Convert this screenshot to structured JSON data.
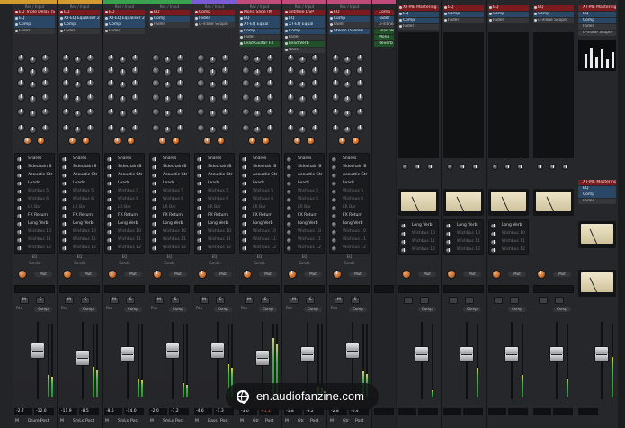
{
  "strips": [
    {
      "name": "Snare Delay",
      "name_color": "#e08a3a",
      "top_color": "#d39a2e",
      "io_label": "Rec / Input",
      "inserts": [
        {
          "label": "EQ Triple Delay (S",
          "kind": "red"
        },
        {
          "label": "EQ",
          "kind": "blue"
        },
        {
          "label": "Comp",
          "kind": "blue"
        },
        {
          "label": "Fader",
          "kind": "grey"
        }
      ],
      "sends": [
        "Snares",
        "Sidechain B",
        "Acoustic Gtr",
        "Leads",
        "Wishbus 5",
        "Wishbus 6",
        "LR Bar",
        "FX Return",
        "Long Verb",
        "Wishbus 10",
        "Wishbus 11",
        "Wishbus 12"
      ],
      "level": "-2.7",
      "peak": "-12.0",
      "peak_red": false,
      "meter": 0.3,
      "fader": 0.55,
      "pan_label": "Pan",
      "bus_label": "EQ",
      "send_label": "Sends",
      "mute": "M",
      "solo": "S",
      "footer": [
        "M",
        "Drums",
        "Post"
      ]
    },
    {
      "name": "Loop 1",
      "name_color": "#e08a3a",
      "top_color": "#d39a2e",
      "io_label": "Rec / Input",
      "inserts": [
        {
          "label": "EQ",
          "kind": "red"
        },
        {
          "label": "XT-EQ Equaliser 2",
          "kind": "blue"
        },
        {
          "label": "Comp",
          "kind": "blue"
        },
        {
          "label": "Fader",
          "kind": "grey"
        }
      ],
      "sends": [
        "Snares",
        "Sidechain B",
        "Acoustic Gtr",
        "Leads",
        "Wishbus 5",
        "Wishbus 6",
        "LR Bar",
        "FX Return",
        "Long Verb",
        "Wishbus 10",
        "Wishbus 11",
        "Wishbus 12"
      ],
      "level": "-11.9",
      "peak": "-8.5",
      "peak_red": false,
      "meter": 0.42,
      "fader": 0.45,
      "pan_label": "Pan",
      "bus_label": "EQ",
      "send_label": "Sends",
      "mute": "M",
      "solo": "S",
      "footer": [
        "M",
        "SmLs",
        "Post"
      ]
    },
    {
      "name": "Loop 2",
      "name_color": "#e08a3a",
      "top_color": "#3aa24f",
      "io_label": "Rec / Input",
      "inserts": [
        {
          "label": "EQ",
          "kind": "red"
        },
        {
          "label": "XT-EQ Equaliser 2",
          "kind": "blue"
        },
        {
          "label": "Comp",
          "kind": "blue"
        },
        {
          "label": "Fader",
          "kind": "grey"
        }
      ],
      "sends": [
        "Snares",
        "Sidechain B",
        "Acoustic Gtr",
        "Leads",
        "Wishbus 5",
        "Wishbus 6",
        "LR Bar",
        "FX Return",
        "Long Verb",
        "Wishbus 10",
        "Wishbus 11",
        "Wishbus 12"
      ],
      "level": "-8.5",
      "peak": "-14.0",
      "peak_red": false,
      "meter": 0.25,
      "fader": 0.5,
      "pan_label": "Pan",
      "bus_label": "EQ",
      "send_label": "Sends",
      "mute": "M",
      "solo": "S",
      "footer": [
        "M",
        "SmLs",
        "Post"
      ]
    },
    {
      "name": "Swell",
      "name_color": "#5bc36a",
      "top_color": "#3aa24f",
      "io_label": "Rec / Input",
      "inserts": [
        {
          "label": "EQ",
          "kind": "red"
        },
        {
          "label": "Comp",
          "kind": "blue"
        },
        {
          "label": "Fader",
          "kind": "grey"
        }
      ],
      "sends": [
        "Snares",
        "Sidechain B",
        "Acoustic Gtr",
        "Leads",
        "Wishbus 5",
        "Wishbus 6",
        "LR Bar",
        "FX Return",
        "Long Verb",
        "Wishbus 10",
        "Wishbus 11",
        "Wishbus 12"
      ],
      "level": "-2.0",
      "peak": "-7.2",
      "peak_red": false,
      "meter": 0.2,
      "fader": 0.55,
      "pan_label": "Pan",
      "bus_label": "EQ",
      "send_label": "Sends",
      "mute": "M",
      "solo": "S",
      "footer": [
        "M",
        "SmLs",
        "Post"
      ]
    },
    {
      "name": "Bass",
      "name_color": "#4f7fd6",
      "top_color": "#7b5bd6",
      "io_label": "Rec / Input",
      "inserts": [
        {
          "label": "Comp",
          "kind": "red"
        },
        {
          "label": "Fader",
          "kind": "blue"
        },
        {
          "label": "u-inline Scope",
          "kind": "grey"
        }
      ],
      "sends": [
        "Snares",
        "Sidechain B",
        "Acoustic Gtr",
        "Leads",
        "Wishbus 5",
        "Wishbus 6",
        "LR Bar",
        "FX Return",
        "Long Verb",
        "Wishbus 10",
        "Wishbus 11",
        "Wishbus 12"
      ],
      "level": "-4.6",
      "peak": "-1.3",
      "peak_red": false,
      "meter": 0.45,
      "fader": 0.55,
      "pan_label": "Pan",
      "bus_label": "EQ",
      "send_label": "Sends",
      "mute": "M",
      "solo": "S",
      "footer": [
        "M",
        "Bass",
        "Post"
      ]
    },
    {
      "name": "Lead Guitar",
      "name_color": "#e05a5a",
      "top_color": "#c04a7a",
      "io_label": "Rec / Input",
      "inserts": [
        {
          "label": "Mono Slide (M",
          "kind": "red"
        },
        {
          "label": "EQ",
          "kind": "blue"
        },
        {
          "label": "XT-EQ Equal",
          "kind": "blue"
        },
        {
          "label": "Comp",
          "kind": "blue"
        },
        {
          "label": "Fader",
          "kind": "grey"
        },
        {
          "label": "Lead Guitar FX",
          "kind": "grn"
        }
      ],
      "sends": [
        "Snares",
        "Sidechain B",
        "Acoustic Gtr",
        "Leads",
        "Wishbus 5",
        "Wishbus 6",
        "LR Bar",
        "FX Return",
        "Long Verb",
        "Wishbus 10",
        "Wishbus 11",
        "Wishbus 12"
      ],
      "level": "-3.0",
      "peak": "+1.2",
      "peak_red": true,
      "meter": 0.8,
      "fader": 0.45,
      "pan_label": "Pan",
      "bus_label": "EQ",
      "send_label": "Sends",
      "mute": "M",
      "solo": "S",
      "footer": [
        "M",
        "Gtr",
        "Post"
      ]
    },
    {
      "name": "MIDI",
      "name_color": "#d04ab0",
      "top_color": "#c04a7a",
      "io_label": "Rec / Input",
      "inserts": [
        {
          "label": "antifree DSP",
          "kind": "red"
        },
        {
          "label": "EQ",
          "kind": "blue"
        },
        {
          "label": "XT-EQ Equal",
          "kind": "blue"
        },
        {
          "label": "Comp",
          "kind": "blue"
        },
        {
          "label": "Fader",
          "kind": "grey"
        },
        {
          "label": "Lead Verb",
          "kind": "grn"
        },
        {
          "label": "Bass",
          "kind": "grey"
        }
      ],
      "sends": [
        "Snares",
        "Sidechain B",
        "Acoustic Gtr",
        "Leads",
        "Wishbus 5",
        "Wishbus 6",
        "LR Bar",
        "FX Return",
        "Long Verb",
        "Wishbus 10",
        "Wishbus 11",
        "Wishbus 12"
      ],
      "level": "-5.8",
      "peak": "-9.2",
      "peak_red": false,
      "meter": 0.15,
      "fader": 0.5,
      "pan_label": "Pan",
      "bus_label": "EQ",
      "send_label": "Sends",
      "mute": "M",
      "solo": "S",
      "footer": [
        "M",
        "Gtr",
        "Post"
      ]
    },
    {
      "name": "Lead Guitar FX",
      "name_color": "#e05a5a",
      "top_color": "#c04a7a",
      "io_label": "Rec / Input",
      "inserts": [
        {
          "label": "EQ",
          "kind": "red"
        },
        {
          "label": "Comp",
          "kind": "blue"
        },
        {
          "label": "Fader",
          "kind": "grey"
        },
        {
          "label": "Stereo (Sterel)",
          "kind": "blue"
        }
      ],
      "sends": [
        "Snares",
        "Sidechain B",
        "Acoustic Gtr",
        "Leads",
        "Wishbus 5",
        "Wishbus 6",
        "LR Bar",
        "FX Return",
        "Long Verb",
        "Wishbus 10",
        "Wishbus 11",
        "Wishbus 12"
      ],
      "level": "-2.8",
      "peak": "-0.4",
      "peak_red": false,
      "meter": 0.35,
      "fader": 0.55,
      "pan_label": "Pan",
      "bus_label": "EQ",
      "send_label": "Sends",
      "mute": "M",
      "solo": "S",
      "footer": [
        "M",
        "Gtr",
        "Post"
      ]
    }
  ],
  "right_edge_strip": {
    "label": "Cho",
    "name_color": "#d04ab0",
    "inserts": [
      {
        "label": "Comp",
        "kind": "red"
      },
      {
        "label": "Fader",
        "kind": "blue"
      },
      {
        "label": "u-inline Sc",
        "kind": "grey"
      },
      {
        "label": "Lead Verb",
        "kind": "grn"
      },
      {
        "label": "Mono",
        "kind": "grn"
      },
      {
        "label": "Reverb",
        "kind": "grn"
      }
    ],
    "level": "-12.3"
  },
  "fx_strips": [
    {
      "name": "Leads",
      "name_color": "#5bc36a",
      "inserts": [
        {
          "label": "XT-ME Mastering 1",
          "kind": "red"
        },
        {
          "label": "EQ",
          "kind": "blue"
        },
        {
          "label": "Comp",
          "kind": "blue"
        },
        {
          "label": "Fader",
          "kind": "grey"
        }
      ],
      "sends": [
        "Long Verb",
        "Wishbus 10",
        "Wishbus 11",
        "Wishbus 12"
      ],
      "level": "-2.6",
      "peak": "-8.3",
      "meter": 0.1,
      "fader": 0.5,
      "split_label": "Split",
      "mute": "M",
      "solo": "S",
      "footer": [
        "M",
        "Bal/Ins",
        "Post"
      ]
    },
    {
      "name": "LD Gtr",
      "name_color": "#5bc36a",
      "inserts": [
        {
          "label": "EQ",
          "kind": "red"
        },
        {
          "label": "Comp",
          "kind": "blue"
        },
        {
          "label": "Fader",
          "kind": "grey"
        }
      ],
      "sends": [
        "Long Verb",
        "Wishbus 10",
        "Wishbus 11",
        "Wishbus 12"
      ],
      "level": "-1.0",
      "peak": "-4.6",
      "meter": 0.4,
      "fader": 0.5,
      "split_label": "Split",
      "mute": "M",
      "solo": "S",
      "footer": [
        "M",
        "Bal/Ins",
        "Post"
      ]
    },
    {
      "name": "FX Return",
      "name_color": "#5bc36a",
      "inserts": [
        {
          "label": "EQ",
          "kind": "red"
        },
        {
          "label": "Comp",
          "kind": "blue"
        },
        {
          "label": "Fader",
          "kind": "grey"
        }
      ],
      "sends": [
        "Long Verb",
        "Wishbus 10",
        "Wishbus 11",
        "Wishbus 12"
      ],
      "level": "-0.0",
      "peak": "-7.7",
      "meter": 0.3,
      "fader": 0.5,
      "split_label": "Split",
      "mute": "M",
      "solo": "S",
      "footer": [
        "M",
        "Bal/Ins",
        "Post"
      ]
    },
    {
      "name": "Long Verb",
      "name_color": "#5bc36a",
      "inserts": [
        {
          "label": "EQ",
          "kind": "red"
        },
        {
          "label": "Comp",
          "kind": "blue"
        },
        {
          "label": "u-inline Scope",
          "kind": "grey"
        }
      ],
      "sends": [],
      "level": "-2.0",
      "peak": "-1.3",
      "meter": 0.25,
      "fader": 0.5,
      "split_label": "Split",
      "mute": "M",
      "solo": "S",
      "footer": [
        "M",
        "Bal/Ins",
        "Post"
      ]
    }
  ],
  "master_strip": {
    "inserts": [
      {
        "label": "XT-ME Mastering",
        "kind": "red"
      },
      {
        "label": "EQ",
        "kind": "blue"
      },
      {
        "label": "Comp",
        "kind": "blue"
      },
      {
        "label": "Fader",
        "kind": "grey"
      },
      {
        "label": "u-inline Scope",
        "kind": "grey"
      }
    ],
    "lower_inserts": [
      {
        "label": "XT-MC Mastering",
        "kind": "red"
      },
      {
        "label": "EQ",
        "kind": "blue"
      },
      {
        "label": "Comp",
        "kind": "blue"
      },
      {
        "label": "Fader",
        "kind": "grey"
      }
    ],
    "meter": 0.55,
    "fader": 0.5,
    "level": "-1.8",
    "footer": "M Monitor"
  },
  "watermark": "en.audiofanzine.com"
}
